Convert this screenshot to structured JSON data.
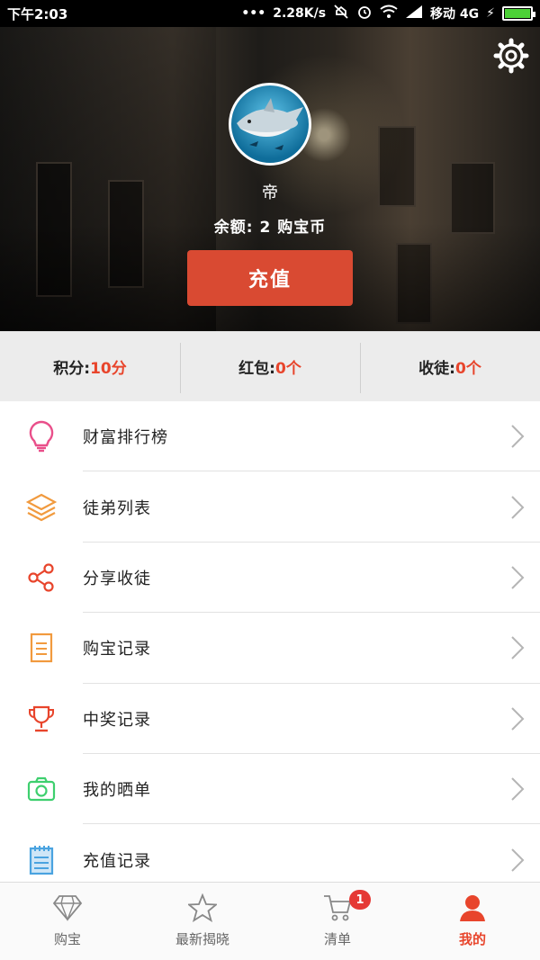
{
  "status_bar": {
    "time": "下午2:03",
    "network_speed": "2.28K/s",
    "carrier": "移动 4G"
  },
  "profile": {
    "username": "帝",
    "balance_text": "余额: 2 购宝币",
    "recharge_label": "充值"
  },
  "stats": [
    {
      "label": "积分:",
      "value": "10分"
    },
    {
      "label": "红包:",
      "value": "0个"
    },
    {
      "label": "收徒:",
      "value": "0个"
    }
  ],
  "menu": [
    {
      "label": "财富排行榜",
      "icon": "lightbulb-icon",
      "color": "#e94f8a"
    },
    {
      "label": "徒弟列表",
      "icon": "layers-icon",
      "color": "#f19a3e"
    },
    {
      "label": "分享收徒",
      "icon": "share-icon",
      "color": "#e8452c"
    },
    {
      "label": "购宝记录",
      "icon": "document-icon",
      "color": "#f19a3e"
    },
    {
      "label": "中奖记录",
      "icon": "trophy-icon",
      "color": "#e8452c"
    },
    {
      "label": "我的晒单",
      "icon": "camera-icon",
      "color": "#3ecf6e"
    },
    {
      "label": "充值记录",
      "icon": "notepad-icon",
      "color": "#4aa3e0"
    }
  ],
  "tabs": [
    {
      "label": "购宝",
      "icon": "diamond-icon"
    },
    {
      "label": "最新揭晓",
      "icon": "star-icon"
    },
    {
      "label": "清单",
      "icon": "cart-icon",
      "badge": "1"
    },
    {
      "label": "我的",
      "icon": "user-icon"
    }
  ],
  "colors": {
    "accent": "#e8452c",
    "button": "#d94a32"
  }
}
